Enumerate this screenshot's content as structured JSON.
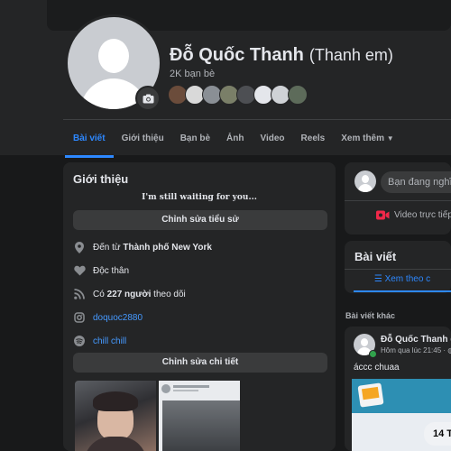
{
  "profile": {
    "name": "Đỗ Quốc Thanh",
    "nickname": "(Thanh em)",
    "friends_count": "2K bạn bè",
    "friend_avatar_colors": [
      "#6b4c3b",
      "#d9d9d9",
      "#8a8f95",
      "#7a7f68",
      "#4d4f53",
      "#e4e6eb",
      "#cfd2d6",
      "#5d6b5a"
    ]
  },
  "tabs": [
    {
      "label": "Bài viết"
    },
    {
      "label": "Giới thiệu"
    },
    {
      "label": "Bạn bè"
    },
    {
      "label": "Ảnh"
    },
    {
      "label": "Video"
    },
    {
      "label": "Reels"
    },
    {
      "label": "Xem thêm"
    }
  ],
  "intro": {
    "title": "Giới thiệu",
    "bio": "I'm still waiting for you...",
    "edit_bio_button": "Chỉnh sửa tiểu sử",
    "hometown_prefix": "Đến từ",
    "hometown": "Thành phố New York",
    "relationship": "Độc thân",
    "followers_prefix": "Có",
    "followers_count": "227 người",
    "followers_suffix": "theo dõi",
    "instagram": "doquoc2880",
    "spotify": "chill chill",
    "edit_details_button": "Chỉnh sửa chi tiết"
  },
  "composer": {
    "placeholder": "Bạn đang nghĩ",
    "live_video": "Video trực tiếp"
  },
  "posts_section": {
    "title": "Bài viết",
    "filter_label": "Xem theo c"
  },
  "other_posts_label": "Bài viết khác",
  "feed_post": {
    "author": "Đỗ Quốc Thanh",
    "action": "đã",
    "time": "Hôm qua lúc 21:45 ·",
    "text": "áccc chuaa",
    "preview_badge": "14 T"
  },
  "colors": {
    "accent": "#2d88ff",
    "live_red": "#f02849"
  }
}
